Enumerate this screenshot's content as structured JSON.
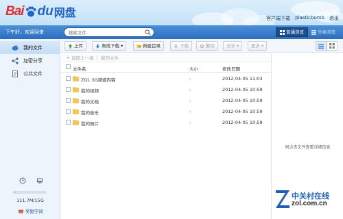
{
  "header": {
    "logo_left": "Bai",
    "logo_du": "du",
    "logo_product": "网盘",
    "links": [
      "客户端下载",
      "plasticbomb",
      "退出"
    ]
  },
  "toolbar_top": {
    "greeting": "下午好，欢迎回来",
    "search_placeholder": "搜索文件",
    "view_switch": [
      "普通浏览",
      "分类浏览"
    ]
  },
  "sidebar": {
    "items": [
      {
        "label": "我的文件",
        "icon": "cloud-icon",
        "active": true
      },
      {
        "label": "加密分享",
        "icon": "share-icon",
        "active": false
      },
      {
        "label": "公共文件",
        "icon": "document-icon",
        "active": false
      }
    ],
    "quota_text": "111.7M/15G",
    "quota_fraction": 0.0073,
    "reward_label": "奖励空间"
  },
  "toolbar": {
    "upload": "上传",
    "offline": "离线下载",
    "new_folder": "新建目录",
    "download": "下载",
    "delete": "删除",
    "share": "分享",
    "more": "更多"
  },
  "breadcrumb": {
    "back": "返回上一级",
    "current": "我的文件"
  },
  "table": {
    "columns": [
      "文件名",
      "大小",
      "修改日期"
    ],
    "rows": [
      {
        "name": "ZOL 3G频道内容",
        "size": "-",
        "date": "2012-04-05 11:03"
      },
      {
        "name": "我的视频",
        "size": "-",
        "date": "2012-04-05 10:59"
      },
      {
        "name": "我的文档",
        "size": "-",
        "date": "2012-04-05 10:59"
      },
      {
        "name": "我的音乐",
        "size": "-",
        "date": "2012-04-05 10:59"
      },
      {
        "name": "我的照片",
        "size": "-",
        "date": "2012-04-05 10:59"
      }
    ]
  },
  "detail": {
    "hint": "同点击文件查看详细信息"
  },
  "watermark": {
    "cn": "中关村在线",
    "en": "zol.com.cn"
  },
  "colors": {
    "brand_blue": "#2d6fbe",
    "logo_red": "#e23030",
    "folder_yellow": "#f5c84c"
  }
}
